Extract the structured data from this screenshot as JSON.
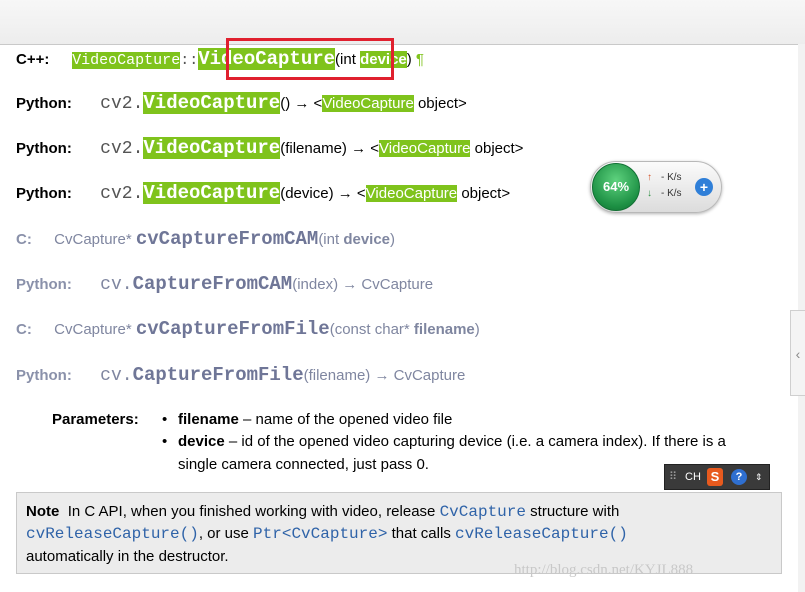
{
  "signatures": [
    {
      "label": "C++:",
      "pre": "",
      "ns": "VideoCapture",
      "sep": "::",
      "func": "VideoCapture",
      "open": "(int ",
      "param": "device",
      "close": ")",
      "tail": " ¶"
    },
    {
      "label": "Python:",
      "prefix": "cv2.",
      "func": "VideoCapture",
      "args": "()",
      "arrow": " → <",
      "obj": "VideoCapture",
      "suffix": " object>"
    },
    {
      "label": "Python:",
      "prefix": "cv2.",
      "func": "VideoCapture",
      "args": "(filename)",
      "arrow": " → <",
      "obj": "VideoCapture",
      "suffix": " object>"
    },
    {
      "label": "Python:",
      "prefix": "cv2.",
      "func": "VideoCapture",
      "args": "(device)",
      "arrow": " → <",
      "obj": "VideoCapture",
      "suffix": " object>"
    },
    {
      "label": "C:",
      "type": "CvCapture* ",
      "func": "cvCaptureFromCAM",
      "open": "(int ",
      "param": "device",
      "close": ")"
    },
    {
      "label": "Python:",
      "prefix": "cv.",
      "func": "CaptureFromCAM",
      "args": "(index)",
      "ret": " → CvCapture"
    },
    {
      "label": "C:",
      "type": "CvCapture* ",
      "func": "cvCaptureFromFile",
      "open": "(const char* ",
      "param": "filename",
      "close": ")"
    },
    {
      "label": "Python:",
      "prefix": "cv.",
      "func": "CaptureFromFile",
      "args": "(filename)",
      "ret": " → CvCapture"
    }
  ],
  "parameters": {
    "label": "Parameters:",
    "items": [
      {
        "name": "filename",
        "desc": " – name of the opened video file"
      },
      {
        "name": "device",
        "desc": " – id of the opened video capturing device (i.e. a camera index). If there is a",
        "desc2": "single camera connected, just pass 0."
      }
    ]
  },
  "note": {
    "label": "Note",
    "l1a": "In C API, when you finished working with video, release ",
    "l1code": "CvCapture",
    "l1b": " structure with",
    "l2code1": "cvReleaseCapture()",
    "l2a": ", or use ",
    "l2code2": "Ptr<CvCapture>",
    "l2b": " that calls ",
    "l2code3": "cvReleaseCapture()",
    "l3": "automatically in the destructor."
  },
  "speed_widget": {
    "percent": "64%",
    "up": "- K/s",
    "down": "- K/s",
    "up_icon": "up-arrow-icon",
    "down_icon": "down-arrow-icon",
    "plus_icon": "plus-icon"
  },
  "ime_toolbar": {
    "lang": "CH",
    "logo": "S",
    "help": "?"
  },
  "watermark": "http://blog.csdn.net/KYJL888",
  "colors": {
    "highlight": "#7fc31c",
    "dim_text": "#7f86a0",
    "code": "#2f63a8",
    "red_box": "#e0202e"
  }
}
